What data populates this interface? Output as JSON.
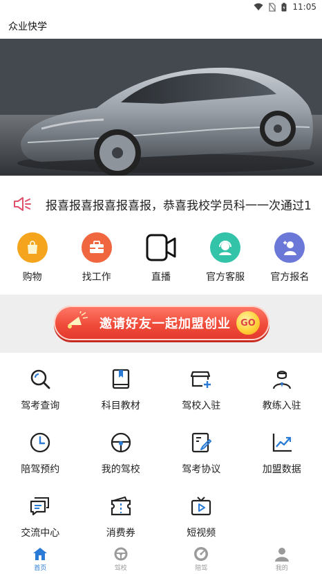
{
  "status_bar": {
    "time": "11:05"
  },
  "header": {
    "title": "众业快学"
  },
  "banner": {
    "slides": 2,
    "active_slide": 0
  },
  "notice": {
    "text": "报喜报喜报喜报喜报，恭喜我校学员科一一次通过1"
  },
  "quick_actions": [
    {
      "label": "购物",
      "icon": "shopping-bag-icon",
      "color": "#f5a51d"
    },
    {
      "label": "找工作",
      "icon": "briefcase-icon",
      "color": "#f0663e"
    },
    {
      "label": "直播",
      "icon": "video-camera-icon",
      "color": "#111111"
    },
    {
      "label": "官方客服",
      "icon": "customer-service-icon",
      "color": "#33c3a9"
    },
    {
      "label": "官方报名",
      "icon": "user-add-icon",
      "color": "#6b78d8"
    }
  ],
  "invite": {
    "label": "邀请好友一起加盟创业",
    "badge": "GO"
  },
  "services": [
    {
      "label": "驾考查询",
      "icon": "search-icon"
    },
    {
      "label": "科目教材",
      "icon": "book-icon"
    },
    {
      "label": "驾校入驻",
      "icon": "store-add-icon"
    },
    {
      "label": "教练入驻",
      "icon": "coach-icon"
    },
    {
      "label": "陪驾预约",
      "icon": "clock-icon"
    },
    {
      "label": "我的驾校",
      "icon": "steering-wheel-icon"
    },
    {
      "label": "驾考协议",
      "icon": "document-edit-icon"
    },
    {
      "label": "加盟数据",
      "icon": "chart-icon"
    },
    {
      "label": "交流中心",
      "icon": "chat-icon"
    },
    {
      "label": "消费券",
      "icon": "coupon-icon"
    },
    {
      "label": "短视频",
      "icon": "tv-icon"
    }
  ],
  "tabs": [
    {
      "label": "首页",
      "icon": "home-icon",
      "active": true
    },
    {
      "label": "驾校",
      "icon": "steering-wheel-icon",
      "active": false
    },
    {
      "label": "陪驾",
      "icon": "gauge-icon",
      "active": false
    },
    {
      "label": "我的",
      "icon": "profile-icon",
      "active": false
    }
  ],
  "colors": {
    "accent": "#2a7bd6",
    "icon_blue": "#2a7bd6",
    "invite_red": "#ee4a3a",
    "notice_icon": "#e0506b"
  }
}
